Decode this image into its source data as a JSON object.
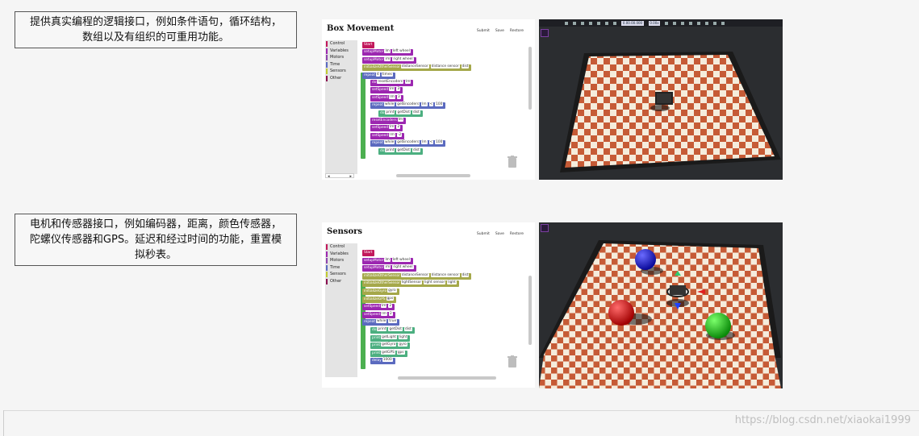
{
  "section1": {
    "description": "提供真实编程的逻辑接口，例如条件语句，循环结构，数组以及有组织的可重用功能。",
    "editor": {
      "title": "Box Movement",
      "buttons": [
        "Submit",
        "Save",
        "Restore"
      ],
      "categories": [
        {
          "label": "Control",
          "color": "#c2185b"
        },
        {
          "label": "Variables",
          "color": "#9c27b0"
        },
        {
          "label": "Motors",
          "color": "#8e44ad"
        },
        {
          "label": "Time",
          "color": "#5c6bc0"
        },
        {
          "label": "Sensors",
          "color": "#c0ca33"
        },
        {
          "label": "Other",
          "color": "#880e4f"
        }
      ],
      "blocks": [
        {
          "text": "Start",
          "color": "#c2185b",
          "indent": 0
        },
        {
          "text": "setupMotor",
          "inputs": [
            "lm",
            "left wheel"
          ],
          "color": "#9c27b0",
          "indent": 0
        },
        {
          "text": "setupMotor",
          "inputs": [
            "rm",
            "right wheel"
          ],
          "color": "#9c27b0",
          "indent": 0
        },
        {
          "text": "initializeOtherSensor",
          "inputs": [
            "distanceSensor",
            "distance sensor",
            "dist"
          ],
          "color": "#a5a84a",
          "indent": 0
        },
        {
          "text": "repeat",
          "inputs": [
            "4",
            "times"
          ],
          "color": "#5b6abf",
          "indent": 0
        },
        {
          "text": "do",
          "inputs": [
            "resetEncoders",
            "lm"
          ],
          "color": "#9c27b0",
          "indent": 1
        },
        {
          "text": "setSpeed",
          "inputs": [
            "lm",
            "3"
          ],
          "color": "#9c27b0",
          "indent": 1
        },
        {
          "text": "setSpeed",
          "inputs": [
            "rm",
            "3"
          ],
          "color": "#9c27b0",
          "indent": 1
        },
        {
          "text": "repeat",
          "inputs": [
            "while",
            "getEncoders",
            "lm",
            "<",
            "100"
          ],
          "color": "#5b6abf",
          "indent": 1
        },
        {
          "text": "do",
          "inputs": [
            "print",
            "getDist",
            "dist"
          ],
          "color": "#4caf80",
          "indent": 2
        },
        {
          "text": "resetEncoders",
          "inputs": [
            "lm"
          ],
          "color": "#9c27b0",
          "indent": 1
        },
        {
          "text": "setSpeed",
          "inputs": [
            "lm",
            "2"
          ],
          "color": "#9c27b0",
          "indent": 1
        },
        {
          "text": "setSpeed",
          "inputs": [
            "rm",
            "-2"
          ],
          "color": "#9c27b0",
          "indent": 1
        },
        {
          "text": "repeat",
          "inputs": [
            "while",
            "getEncoders",
            "lm",
            "<",
            "100"
          ],
          "color": "#5b6abf",
          "indent": 1
        },
        {
          "text": "do",
          "inputs": [
            "print",
            "getDist",
            "dist"
          ],
          "color": "#4caf80",
          "indent": 2
        }
      ]
    },
    "sim": {
      "timer": "0.00.00.000",
      "speed": "0.00x"
    }
  },
  "section2": {
    "description": "电机和传感器接口，例如编码器，距离，颜色传感器，陀螺仪传感器和GPS。延迟和经过时间的功能，重置模拟秒表。",
    "editor": {
      "title": "Sensors",
      "buttons": [
        "Submit",
        "Save",
        "Restore"
      ],
      "categories": [
        {
          "label": "Control",
          "color": "#c2185b"
        },
        {
          "label": "Variables",
          "color": "#9c27b0"
        },
        {
          "label": "Motors",
          "color": "#8e44ad"
        },
        {
          "label": "Time",
          "color": "#5c6bc0"
        },
        {
          "label": "Sensors",
          "color": "#c0ca33"
        },
        {
          "label": "Other",
          "color": "#880e4f"
        }
      ],
      "blocks": [
        {
          "text": "Start",
          "color": "#c2185b",
          "indent": 0
        },
        {
          "text": "setupMotor",
          "inputs": [
            "lm",
            "left wheel"
          ],
          "color": "#9c27b0",
          "indent": 0
        },
        {
          "text": "setupMotor",
          "inputs": [
            "rm",
            "right wheel"
          ],
          "color": "#9c27b0",
          "indent": 0
        },
        {
          "text": "initializeOtherSensor",
          "inputs": [
            "distanceSensor",
            "distance sensor",
            "dist"
          ],
          "color": "#a5a84a",
          "indent": 0
        },
        {
          "text": "initializeOtherSensor",
          "inputs": [
            "lightSensor",
            "light sensor",
            "light"
          ],
          "color": "#a5a84a",
          "indent": 0
        },
        {
          "text": "initializeGyro",
          "inputs": [
            "gyro"
          ],
          "color": "#a5a84a",
          "indent": 0
        },
        {
          "text": "initializeGPS",
          "inputs": [
            "gps"
          ],
          "color": "#a5a84a",
          "indent": 0
        },
        {
          "text": "setSpeed",
          "inputs": [
            "lm",
            "2"
          ],
          "color": "#9c27b0",
          "indent": 0
        },
        {
          "text": "setSpeed",
          "inputs": [
            "rm",
            "2"
          ],
          "color": "#9c27b0",
          "indent": 0
        },
        {
          "text": "repeat",
          "inputs": [
            "while",
            "true"
          ],
          "color": "#5b6abf",
          "indent": 0
        },
        {
          "text": "do",
          "inputs": [
            "print",
            "getDist",
            "dist"
          ],
          "color": "#4caf80",
          "indent": 1
        },
        {
          "text": "print",
          "inputs": [
            "getLight",
            "light"
          ],
          "color": "#4caf80",
          "indent": 1
        },
        {
          "text": "print",
          "inputs": [
            "getGyro",
            "gyro"
          ],
          "color": "#4caf80",
          "indent": 1
        },
        {
          "text": "print",
          "inputs": [
            "getGPS",
            "gps"
          ],
          "color": "#4caf80",
          "indent": 1
        },
        {
          "text": "delay",
          "inputs": [
            "1000"
          ],
          "color": "#5b6abf",
          "indent": 1
        }
      ]
    }
  },
  "watermark": "https://blog.csdn.net/xiaokai1999"
}
